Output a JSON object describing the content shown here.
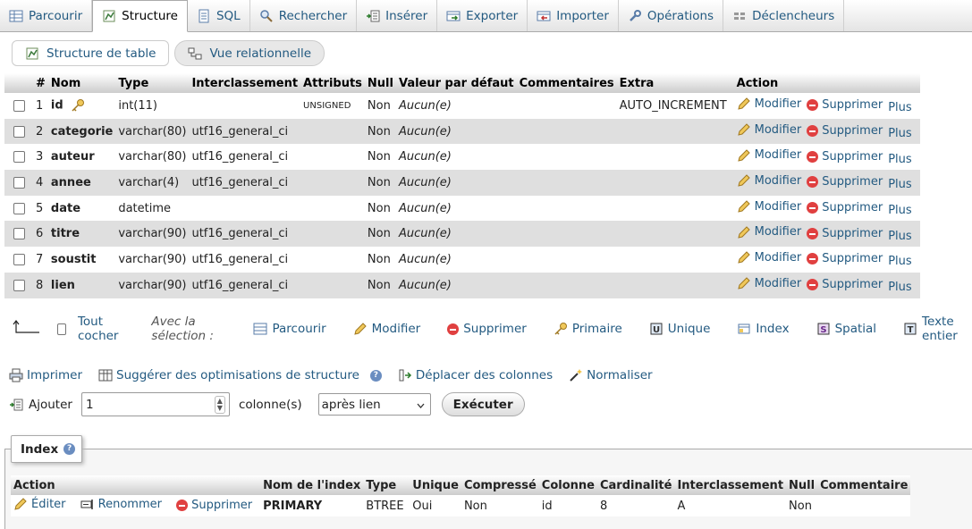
{
  "tabs": [
    {
      "label": "Parcourir",
      "icon": "table-icon"
    },
    {
      "label": "Structure",
      "icon": "structure-icon",
      "active": true
    },
    {
      "label": "SQL",
      "icon": "sql-icon"
    },
    {
      "label": "Rechercher",
      "icon": "search-icon"
    },
    {
      "label": "Insérer",
      "icon": "insert-icon"
    },
    {
      "label": "Exporter",
      "icon": "export-icon"
    },
    {
      "label": "Importer",
      "icon": "import-icon"
    },
    {
      "label": "Opérations",
      "icon": "wrench-icon"
    },
    {
      "label": "Déclencheurs",
      "icon": "trigger-icon"
    }
  ],
  "subtabs": {
    "structure": "Structure de table",
    "relational": "Vue relationnelle"
  },
  "columns_header": [
    "#",
    "Nom",
    "Type",
    "Interclassement",
    "Attributs",
    "Null",
    "Valeur par défaut",
    "Commentaires",
    "Extra",
    "Action"
  ],
  "rows": [
    {
      "num": "1",
      "name": "id",
      "type": "int(11)",
      "collation": "",
      "attributes": "UNSIGNED",
      "null": "Non",
      "default": "Aucun(e)",
      "comment": "",
      "extra": "AUTO_INCREMENT"
    },
    {
      "num": "2",
      "name": "categorie",
      "type": "varchar(80)",
      "collation": "utf16_general_ci",
      "attributes": "",
      "null": "Non",
      "default": "Aucun(e)",
      "comment": "",
      "extra": ""
    },
    {
      "num": "3",
      "name": "auteur",
      "type": "varchar(80)",
      "collation": "utf16_general_ci",
      "attributes": "",
      "null": "Non",
      "default": "Aucun(e)",
      "comment": "",
      "extra": ""
    },
    {
      "num": "4",
      "name": "annee",
      "type": "varchar(4)",
      "collation": "utf16_general_ci",
      "attributes": "",
      "null": "Non",
      "default": "Aucun(e)",
      "comment": "",
      "extra": ""
    },
    {
      "num": "5",
      "name": "date",
      "type": "datetime",
      "collation": "",
      "attributes": "",
      "null": "Non",
      "default": "Aucun(e)",
      "comment": "",
      "extra": ""
    },
    {
      "num": "6",
      "name": "titre",
      "type": "varchar(90)",
      "collation": "utf16_general_ci",
      "attributes": "",
      "null": "Non",
      "default": "Aucun(e)",
      "comment": "",
      "extra": ""
    },
    {
      "num": "7",
      "name": "soustit",
      "type": "varchar(90)",
      "collation": "utf16_general_ci",
      "attributes": "",
      "null": "Non",
      "default": "Aucun(e)",
      "comment": "",
      "extra": ""
    },
    {
      "num": "8",
      "name": "lien",
      "type": "varchar(90)",
      "collation": "utf16_general_ci",
      "attributes": "",
      "null": "Non",
      "default": "Aucun(e)",
      "comment": "",
      "extra": ""
    }
  ],
  "row_actions": {
    "edit": "Modifier",
    "delete": "Supprimer",
    "more": "Plus"
  },
  "selection_bar": {
    "check_all": "Tout cocher",
    "with_selection": "Avec la sélection :",
    "browse": "Parcourir",
    "edit": "Modifier",
    "delete": "Supprimer",
    "primary": "Primaire",
    "unique": "Unique",
    "index": "Index",
    "spatial": "Spatial",
    "fulltext": "Texte entier"
  },
  "tools": {
    "print": "Imprimer",
    "suggest": "Suggérer des optimisations de structure",
    "move": "Déplacer des colonnes",
    "normalize": "Normaliser"
  },
  "add_row": {
    "label": "Ajouter",
    "count": "1",
    "columns_label": "colonne(s)",
    "position": "après lien",
    "execute": "Exécuter"
  },
  "index_section": {
    "legend": "Index",
    "headers": [
      "Action",
      "Nom de l'index",
      "Type",
      "Unique",
      "Compressé",
      "Colonne",
      "Cardinalité",
      "Interclassement",
      "Null",
      "Commentaire"
    ],
    "actions": {
      "edit": "Éditer",
      "rename": "Renommer",
      "delete": "Supprimer"
    },
    "row": {
      "name": "PRIMARY",
      "type": "BTREE",
      "unique": "Oui",
      "compressed": "Non",
      "column": "id",
      "cardinality": "8",
      "collation": "A",
      "null": "Non",
      "comment": ""
    }
  }
}
